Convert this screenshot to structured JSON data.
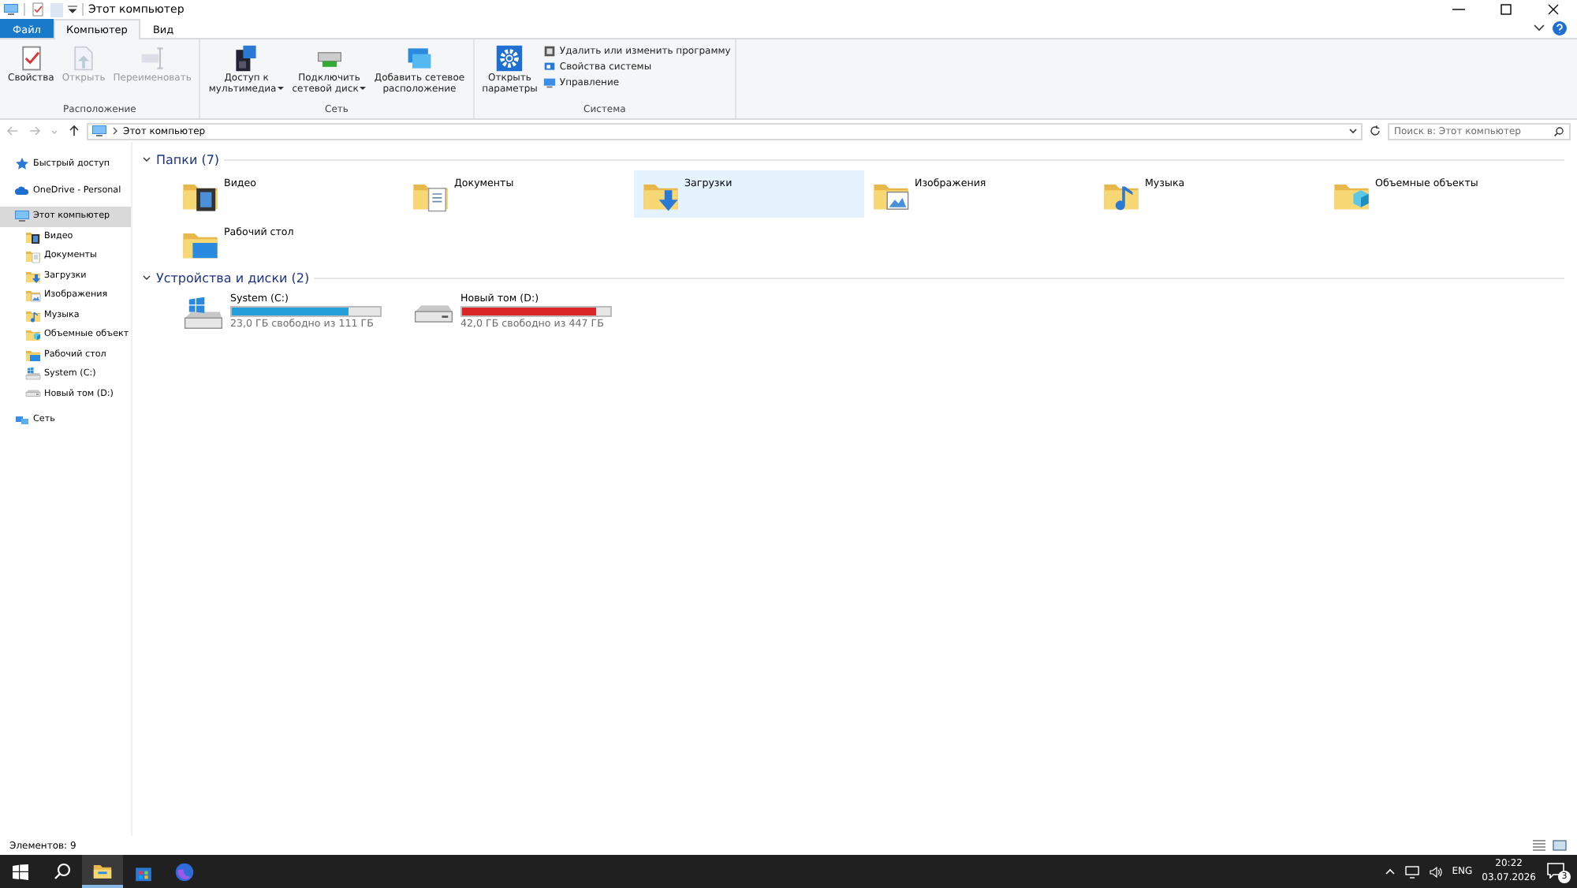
{
  "window": {
    "title": "Этот компьютер"
  },
  "ribbon_tabs": [
    {
      "label": "Файл",
      "kind": "file",
      "selected": false
    },
    {
      "label": "Компьютер",
      "kind": "tab",
      "selected": true
    },
    {
      "label": "Вид",
      "kind": "tab",
      "selected": false
    }
  ],
  "ribbon_groups": [
    {
      "label": "Расположение",
      "buttons": [
        {
          "lines": [
            "Свойства"
          ],
          "disabled": false,
          "dropdown": false
        },
        {
          "lines": [
            "Открыть"
          ],
          "disabled": true,
          "dropdown": false
        },
        {
          "lines": [
            "Переименовать"
          ],
          "disabled": true,
          "dropdown": false
        }
      ]
    },
    {
      "label": "Сеть",
      "buttons": [
        {
          "lines": [
            "Доступ к",
            "мультимедиа"
          ],
          "disabled": false,
          "dropdown": true
        },
        {
          "lines": [
            "Подключить",
            "сетевой диск"
          ],
          "disabled": false,
          "dropdown": true
        },
        {
          "lines": [
            "Добавить сетевое",
            "расположение"
          ],
          "disabled": false,
          "dropdown": false
        }
      ]
    },
    {
      "label": "Система",
      "buttons": [
        {
          "lines": [
            "Открыть",
            "параметры"
          ],
          "disabled": false,
          "dropdown": false
        }
      ],
      "small_buttons": [
        "Удалить или изменить программу",
        "Свойства системы",
        "Управление"
      ]
    }
  ],
  "address": {
    "path": "Этот компьютер",
    "search_placeholder": "Поиск в: Этот компьютер"
  },
  "nav": [
    {
      "label": "Быстрый доступ",
      "selected": false
    },
    {
      "label": "OneDrive - Personal",
      "selected": false
    },
    {
      "label": "Этот компьютер",
      "selected": true,
      "children": [
        {
          "label": "Видео",
          "selected": false
        },
        {
          "label": "Документы",
          "selected": false
        },
        {
          "label": "Загрузки",
          "selected": false
        },
        {
          "label": "Изображения",
          "selected": false
        },
        {
          "label": "Музыка",
          "selected": false
        },
        {
          "label": "Объемные объект",
          "selected": false
        },
        {
          "label": "Рабочий стол",
          "selected": false
        },
        {
          "label": "System (C:)",
          "selected": false
        },
        {
          "label": "Новый том (D:)",
          "selected": false
        }
      ]
    },
    {
      "label": "Сеть",
      "selected": false
    }
  ],
  "folders": {
    "title": "Папки (7)",
    "items": [
      {
        "name": "Видео",
        "selected": false
      },
      {
        "name": "Документы",
        "selected": false
      },
      {
        "name": "Загрузки",
        "selected": true
      },
      {
        "name": "Изображения",
        "selected": false
      },
      {
        "name": "Музыка",
        "selected": false
      },
      {
        "name": "Объемные объекты",
        "selected": false
      },
      {
        "name": "Рабочий стол",
        "selected": false
      }
    ]
  },
  "drives": {
    "title": "Устройства и диски (2)",
    "items": [
      {
        "name": "System (C:)",
        "free": "23,0 ГБ свободно из 111 ГБ",
        "level": 0.79,
        "color": "#26a0da"
      },
      {
        "name": "Новый том (D:)",
        "free": "42,0 ГБ свободно из 447 ГБ",
        "level": 0.906,
        "color": "#da2626"
      }
    ]
  },
  "status_bar": {
    "count": "Элементов: 9"
  },
  "taskbar": {
    "apps": [
      {
        "selected": true
      },
      {
        "selected": false
      },
      {
        "selected": false
      }
    ],
    "language": "ENG",
    "time": "20:22",
    "date": "03.07.2026",
    "notifications": "3"
  }
}
